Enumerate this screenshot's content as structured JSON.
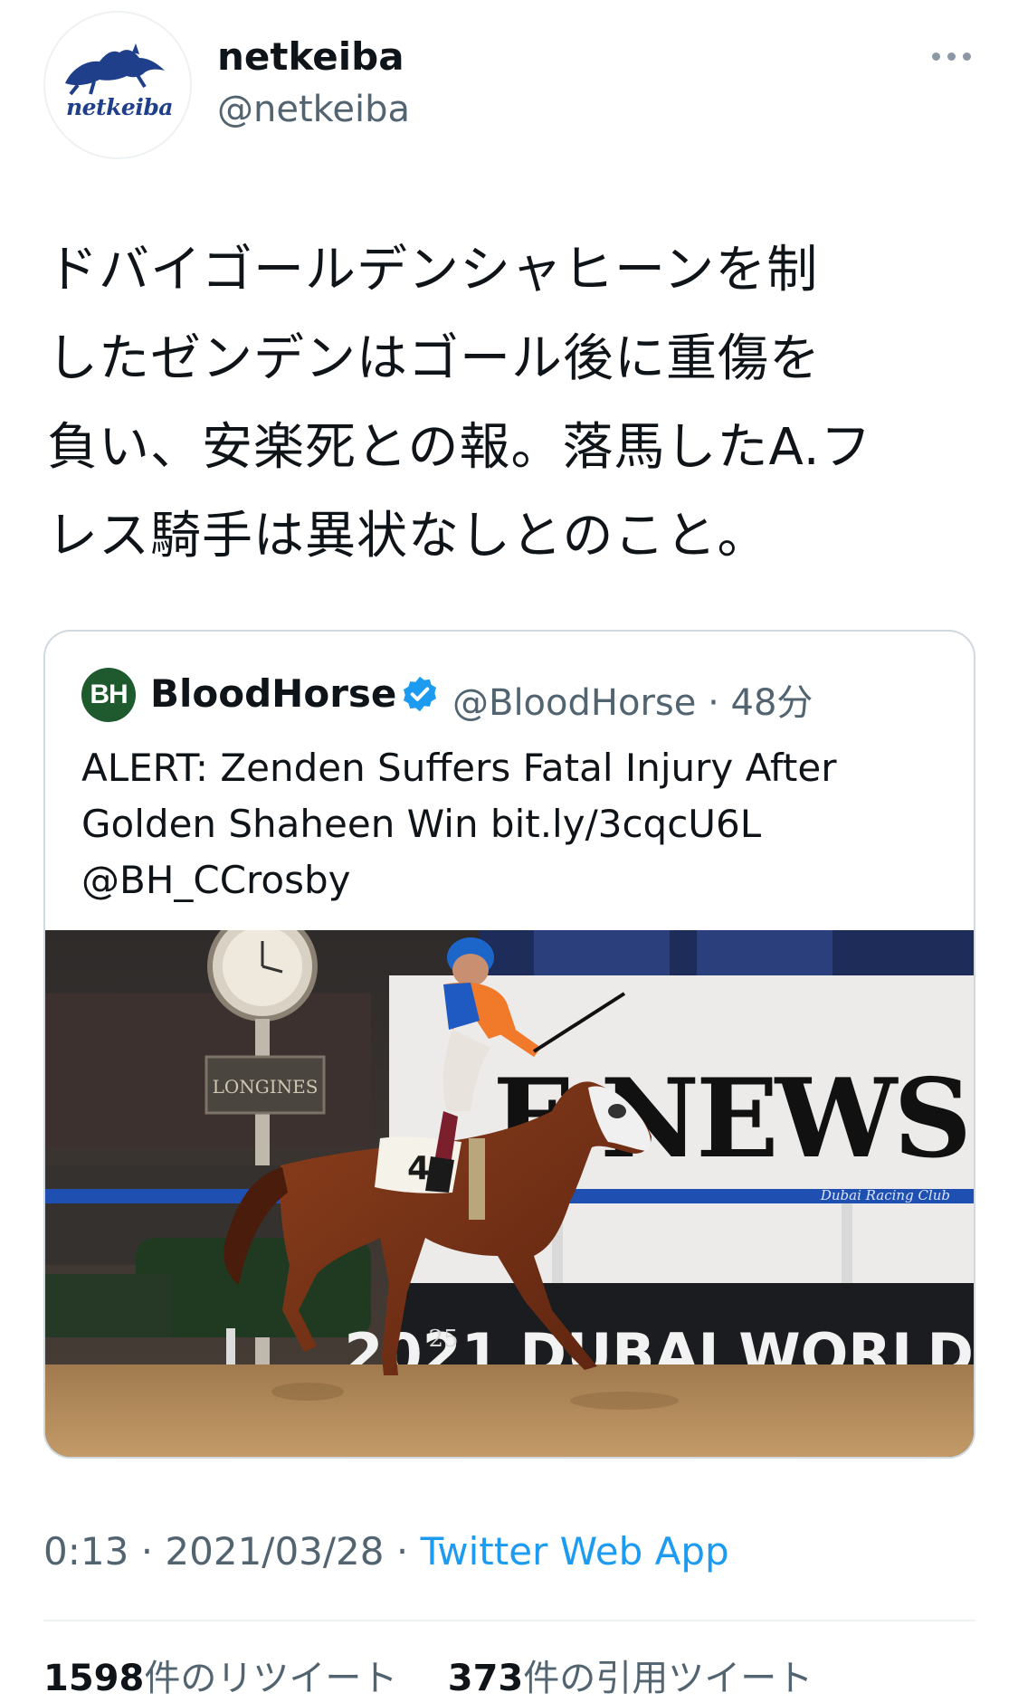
{
  "author": {
    "display_name": "netkeiba",
    "handle": "@netkeiba",
    "avatar_logo_text": "netkeiba"
  },
  "tweet": {
    "lines": [
      "ドバイゴールデンシャヒーンを制",
      "したゼンデンはゴール後に重傷を",
      "負い、安楽死との報。落馬したA.フ",
      "レス騎手は異状なしとのこと。"
    ]
  },
  "quoted_tweet": {
    "avatar_text": "BH",
    "display_name": "BloodHorse",
    "handle": "@BloodHorse",
    "separator": "·",
    "time": "48分",
    "lines": [
      "ALERT: Zenden Suffers Fatal Injury After",
      "Golden Shaheen Win bit.ly/3cqcU6L",
      "@BH_CCrosby"
    ],
    "photo_signage": {
      "board_text": "LONGINES",
      "banner_text": "F NEWS",
      "rail_text": "Dubai Racing Club",
      "footer_text": "2021 DUBAI WORLD",
      "logo_number": "25",
      "saddle_number": "4"
    }
  },
  "meta": {
    "time": "0:13",
    "date": "2021/03/28",
    "dot": "·",
    "source_app": "Twitter Web App"
  },
  "stats": {
    "retweets_count": "1598",
    "retweets_label": "件のリツイート",
    "quotes_count": "373",
    "quotes_label": "件の引用ツイート"
  },
  "colors": {
    "link": "#1d9bf0",
    "secondary_text": "#536471",
    "verified": "#1d9bf0",
    "border": "#cfd9de"
  }
}
